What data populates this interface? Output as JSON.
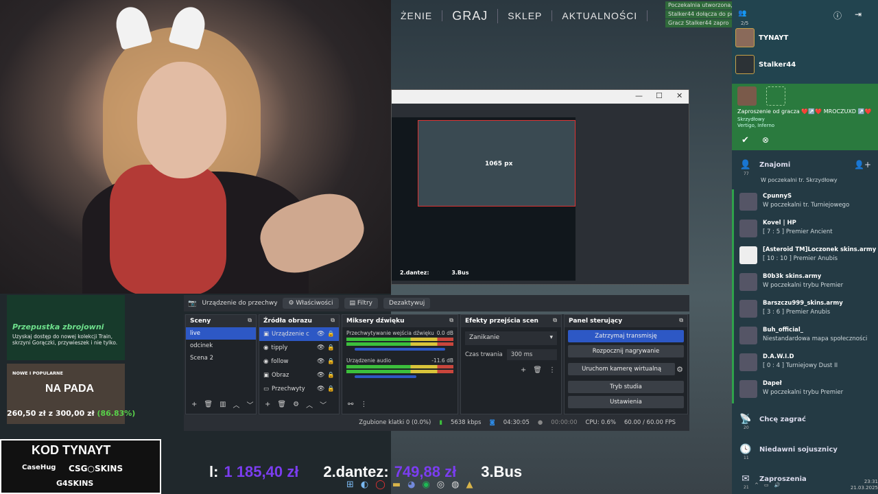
{
  "game_nav": {
    "items": [
      "ŻENIE",
      "GRAJ",
      "SKLEP",
      "AKTUALNOŚCI"
    ]
  },
  "notifications": [
    "Poczekalnia utworzona, ki",
    "Stalker44 dołącza do pocz",
    "Gracz Stalker44 zapro"
  ],
  "sidebar": {
    "party_count": "2/5",
    "party": [
      {
        "name": "TYNAYT"
      },
      {
        "name": "Stalker44"
      }
    ],
    "invite": {
      "title": "Zaproszenie od gracza ❤️↗️❤️ MROCZUXD ↗️❤️",
      "line1": "Skrzydłowy",
      "line2": "Vertigo, Inferno"
    },
    "friends_label": "Znajomi",
    "friends_count": "77",
    "friends_partial": "W poczekalni tr. Skrzydłowy",
    "friends": [
      {
        "name": "CpunnyS",
        "status": "W poczekalni tr. Turniejowego"
      },
      {
        "name": "Kovel | HP",
        "status": "[ 7 : 5 ] Premier Ancient"
      },
      {
        "name": "[Asteroid TM]Loczonek skins.army",
        "status": "[ 10 : 10 ] Premier Anubis"
      },
      {
        "name": "B0b3k skins.army",
        "status": "W poczekalni trybu Premier"
      },
      {
        "name": "Barszczu999_skins.army",
        "status": "[ 3 : 6 ] Premier Anubis"
      },
      {
        "name": "Buh_official_",
        "status": "Niestandardowa mapa społeczności"
      },
      {
        "name": "D.A.W.I.D",
        "status": "[ 0 : 4 ] Turniejowy Dust II"
      },
      {
        "name": "Dapeł",
        "status": "W poczekalni trybu Premier"
      }
    ],
    "menu": [
      {
        "icon": "📡",
        "label": "Chcę zagrać",
        "count": "20"
      },
      {
        "icon": "🕓",
        "label": "Niedawni sojusznicy",
        "count": "11"
      },
      {
        "icon": "✉",
        "label": "Zaproszenia",
        "count": "21"
      }
    ]
  },
  "armory": {
    "title": "Przepustka zbrojowni",
    "desc": "Uzyskaj dostęp do nowej kolekcji Train, skrzyni Gorączki, przywieszek i nie tylko."
  },
  "nowe": {
    "header": "NOWE I POPULARNE",
    "name": "NA PADA",
    "progress_text": "260,50 zł z 300,00 zł",
    "progress_pct": "(86.83%)"
  },
  "kod": {
    "title": "KOD TYNAYT",
    "s1": "CaseHug",
    "s2": "CSG○SKINS",
    "s3": "G4SKINS"
  },
  "obs": {
    "preview_px": "1065 px",
    "preview_lb": "2.dantez:",
    "preview_lb2": "3.Bus",
    "toolbar": {
      "source": "Urządzenie do przechwyty",
      "props": "Właściwości",
      "filters": "Filtry",
      "deactivate": "Dezaktywuj"
    },
    "scenes_title": "Sceny",
    "scenes": [
      "live",
      "odcinek",
      "Scena 2"
    ],
    "sources_title": "Źródła obrazu",
    "sources": [
      "Urządzenie c",
      "tipply",
      "follow",
      "Obraz",
      "Przechwyty"
    ],
    "mixer_title": "Miksery dźwięku",
    "mixer": [
      {
        "name": "Przechwytywanie wejścia dźwięku",
        "db": "0.0 dB"
      },
      {
        "name": "Urządzenie audio",
        "db": "-11.6 dB"
      }
    ],
    "transitions_title": "Efekty przejścia scen",
    "transition": "Zanikanie",
    "duration_label": "Czas trwania",
    "duration": "300 ms",
    "controls_title": "Panel sterujący",
    "controls": [
      "Zatrzymaj transmisję",
      "Rozpocznij nagrywanie",
      "Uruchom kamerę wirtualną",
      "Tryb studia",
      "Ustawienia"
    ],
    "status": {
      "dropped": "Zgubione klatki 0 (0.0%)",
      "kbps": "5638 kbps",
      "live_time": "04:30:05",
      "rec_time": "00:00:00",
      "cpu": "CPU: 0.6%",
      "fps": "60.00 / 60.00 FPS"
    }
  },
  "leaderboard": {
    "first_prefix": "l:",
    "first_value": "1 185,40 zł",
    "second": "2.dantez:",
    "second_value": "749,88 zł",
    "third": "3.Bus"
  },
  "tray": {
    "time": "23:31",
    "date": "21.03.2025"
  },
  "colors": {
    "obs_primary": "#2d58c5",
    "friend_online": "#2fa24b",
    "leader_value": "#7b3df0",
    "progress_pct": "#59d14a"
  }
}
